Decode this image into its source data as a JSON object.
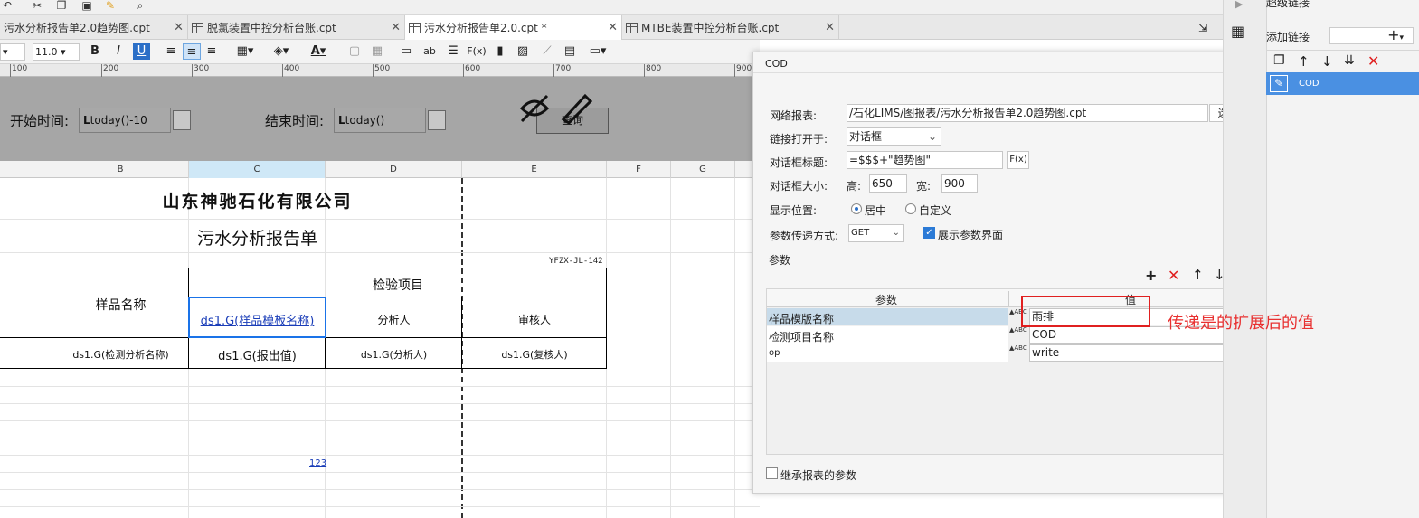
{
  "tabs": [
    {
      "label": "污水分析报告单2.0趋势图.cpt"
    },
    {
      "label": "脱氯装置中控分析台账.cpt"
    },
    {
      "label": "污水分析报告单2.0.cpt *"
    },
    {
      "label": "MTBE装置中控分析台账.cpt"
    }
  ],
  "toolbar": {
    "font_size": "11.0",
    "bold": "B",
    "italic": "I",
    "underline": "U",
    "text_color_icon": "A",
    "formula_icon": "F(x)",
    "ab": "ab"
  },
  "ruler": {
    "ticks": [
      "100",
      "200",
      "300",
      "400",
      "500",
      "600",
      "700",
      "800",
      "900"
    ]
  },
  "params": {
    "start_label": "开始时间:",
    "start_value": "today()-10",
    "end_label": "结束时间:",
    "end_value": "today()",
    "query_label": "查询"
  },
  "columns": [
    "B",
    "C",
    "D",
    "E",
    "F",
    "G"
  ],
  "report": {
    "company": "山东神驰石化有限公司",
    "title": "污水分析报告单",
    "code": "YFZX-JL-142",
    "header_inspect": "检验项目",
    "header_sample": "样品名称",
    "cell_template": "ds1.G(样品模板名称)",
    "header_analyst": "分析人",
    "header_reviewer": "审核人",
    "row_item": "ds1.G(检测分析名称)",
    "row_value": "ds1.G(报出值)",
    "row_analyst": "ds1.G(分析人)",
    "row_reviewer": "ds1.G(复核人)",
    "link_123": "123"
  },
  "dialog": {
    "title": "COD",
    "network_report_label": "网络报表:",
    "network_report_value": "/石化LIMS/图报表/污水分析报告单2.0趋势图.cpt",
    "select_button": "选择",
    "open_in_label": "链接打开于:",
    "open_in_value": "对话框",
    "dialog_title_label": "对话框标题:",
    "dialog_title_value": "=$$$+\"趋势图\"",
    "formula_button": "F(x)",
    "dialog_size_label": "对话框大小:",
    "height_label": "高:",
    "height_value": "650",
    "width_label": "宽:",
    "width_value": "900",
    "display_pos_label": "显示位置:",
    "pos_center": "居中",
    "pos_custom": "自定义",
    "pass_method_label": "参数传递方式:",
    "pass_method_value": "GET",
    "show_param_ui": "展示参数界面",
    "params_section": "参数",
    "table_header_param": "参数",
    "table_header_value": "值",
    "rows": [
      {
        "param": "样品模版名称",
        "value": "雨排"
      },
      {
        "param": "检测项目名称",
        "value": "COD"
      },
      {
        "param": "op",
        "value": "write"
      }
    ],
    "inherit_params": "继承报表的参数"
  },
  "right_panel": {
    "hyperlink_label": "超级链接",
    "add_link_label": "添加链接",
    "link_item": "COD"
  },
  "annotation": "传递是的扩展后的值",
  "colors": {
    "selection": "#1a73e8",
    "annotation": "#e02020",
    "link_item_bg": "#4a90e2"
  }
}
